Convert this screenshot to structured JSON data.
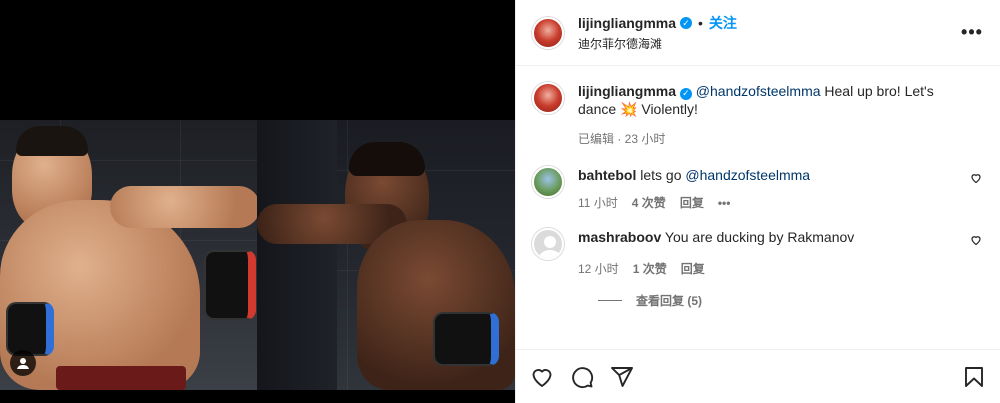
{
  "post": {
    "author": {
      "username": "lijingliangmma",
      "verified_mark": "✓",
      "separator": "•",
      "follow_label": "关注",
      "location": "迪尔菲尔德海滩"
    },
    "more_label": "•••"
  },
  "caption": {
    "username": "lijingliangmma",
    "mention": "@handzofsteelmma",
    "text": " Heal up bro! Let's dance 💥 Violently!",
    "edited": "已编辑 · 23 小时"
  },
  "comments": [
    {
      "username": "bahtebol",
      "text_before": " lets go ",
      "mention": "@handzofsteelmma",
      "time": "11 小时",
      "likes": "4 次赞",
      "reply": "回复",
      "more": "•••"
    },
    {
      "username": "mashraboov",
      "text_before": " You are ducking by Rakmanov",
      "mention": "",
      "time": "12 小时",
      "likes": "1 次赞",
      "reply": "回复"
    }
  ],
  "view_replies": "查看回复 (5)",
  "actions": {
    "like_icon": "heart-icon",
    "comment_icon": "comment-icon",
    "share_icon": "share-icon",
    "save_icon": "bookmark-icon"
  },
  "colors": {
    "accent": "#0095f6",
    "mention": "#00376b",
    "meta": "#737373"
  }
}
